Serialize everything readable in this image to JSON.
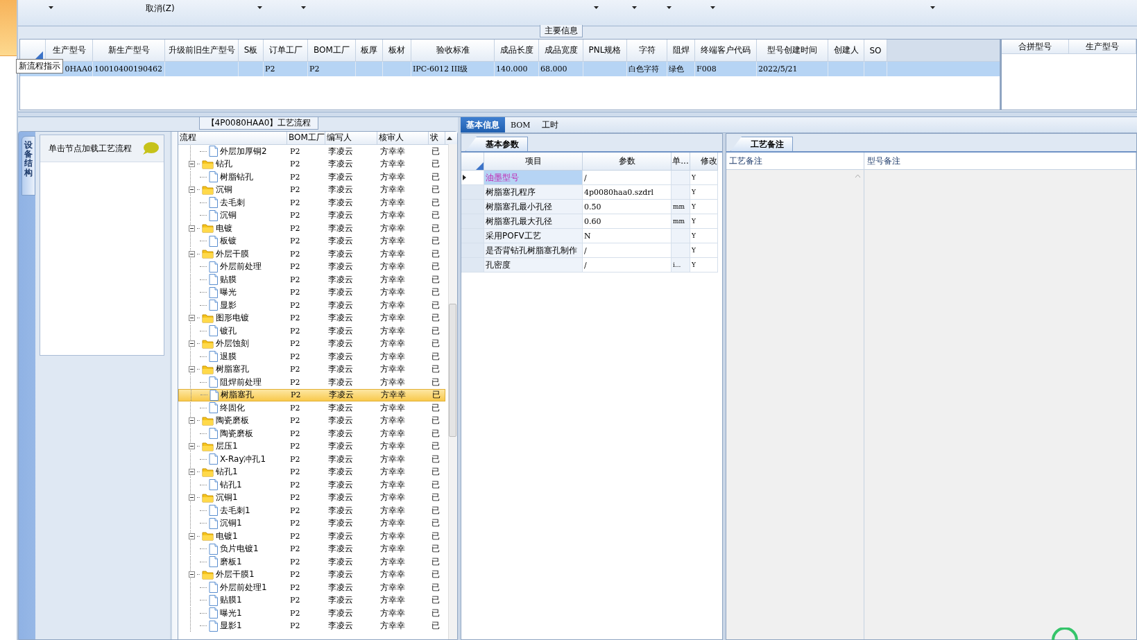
{
  "toolbar": {
    "cancel_label": "取消(Z)"
  },
  "main_info": {
    "title": "主要信息",
    "tooltip": "新流程指示",
    "columns": [
      "生产型号",
      "新生产型号",
      "升级前旧生产型号",
      "S板",
      "订单工厂",
      "BOM工厂",
      "板厚",
      "板材",
      "验收标准",
      "成品长度",
      "成品宽度",
      "PNL规格",
      "字符",
      "阻焊",
      "终端客户代码",
      "型号创建时间",
      "创建人",
      "SO"
    ],
    "rows": [
      {
        "selected": true,
        "cells": [
          "0HAA0",
          "10010400190462",
          "",
          "",
          "P2",
          "P2",
          "",
          "",
          "IPC-6012 III级",
          "140.000",
          "68.000",
          "",
          "白色字符",
          "绿色",
          "F008",
          "2022/5/21",
          "",
          ""
        ]
      }
    ],
    "side_columns": [
      "合拼型号",
      "生产型号"
    ]
  },
  "flow": {
    "title": "【4P0080HAA0】工艺流程",
    "side_tab": "设备结构",
    "hint": "单击节点加载工艺流程",
    "columns": [
      "流程",
      "BOM工厂",
      "编写人",
      "核审人",
      "状"
    ],
    "tree": [
      {
        "name": "外层加厚铜2",
        "kind": "file",
        "selected": false,
        "bom": "P2",
        "writer": "李凌云",
        "reviewer": "方幸幸",
        "status": "已"
      },
      {
        "name": "钻孔",
        "kind": "folder",
        "expanded": true,
        "selected": false,
        "bom": "P2",
        "writer": "李凌云",
        "reviewer": "方幸幸",
        "status": "已",
        "children": [
          {
            "name": "树脂钻孔",
            "kind": "file",
            "selected": false,
            "bom": "P2",
            "writer": "李凌云",
            "reviewer": "方幸幸",
            "status": "已"
          }
        ]
      },
      {
        "name": "沉铜",
        "kind": "folder",
        "expanded": true,
        "selected": false,
        "bom": "P2",
        "writer": "李凌云",
        "reviewer": "方幸幸",
        "status": "已",
        "children": [
          {
            "name": "去毛刺",
            "kind": "file",
            "selected": false,
            "bom": "P2",
            "writer": "李凌云",
            "reviewer": "方幸幸",
            "status": "已"
          },
          {
            "name": "沉铜",
            "kind": "file",
            "selected": false,
            "bom": "P2",
            "writer": "李凌云",
            "reviewer": "方幸幸",
            "status": "已"
          }
        ]
      },
      {
        "name": "电镀",
        "kind": "folder",
        "expanded": true,
        "selected": false,
        "bom": "P2",
        "writer": "李凌云",
        "reviewer": "方幸幸",
        "status": "已",
        "children": [
          {
            "name": "板镀",
            "kind": "file",
            "selected": false,
            "bom": "P2",
            "writer": "李凌云",
            "reviewer": "方幸幸",
            "status": "已"
          }
        ]
      },
      {
        "name": "外层干膜",
        "kind": "folder",
        "expanded": true,
        "selected": false,
        "bom": "P2",
        "writer": "李凌云",
        "reviewer": "方幸幸",
        "status": "已",
        "children": [
          {
            "name": "外层前处理",
            "kind": "file",
            "selected": false,
            "bom": "P2",
            "writer": "李凌云",
            "reviewer": "方幸幸",
            "status": "已"
          },
          {
            "name": "贴膜",
            "kind": "file",
            "selected": false,
            "bom": "P2",
            "writer": "李凌云",
            "reviewer": "方幸幸",
            "status": "已"
          },
          {
            "name": "曝光",
            "kind": "file",
            "selected": false,
            "bom": "P2",
            "writer": "李凌云",
            "reviewer": "方幸幸",
            "status": "已"
          },
          {
            "name": "显影",
            "kind": "file",
            "selected": false,
            "bom": "P2",
            "writer": "李凌云",
            "reviewer": "方幸幸",
            "status": "已"
          }
        ]
      },
      {
        "name": "图形电镀",
        "kind": "folder",
        "expanded": true,
        "selected": false,
        "bom": "P2",
        "writer": "李凌云",
        "reviewer": "方幸幸",
        "status": "已",
        "children": [
          {
            "name": "镀孔",
            "kind": "file",
            "selected": false,
            "bom": "P2",
            "writer": "李凌云",
            "reviewer": "方幸幸",
            "status": "已"
          }
        ]
      },
      {
        "name": "外层蚀刻",
        "kind": "folder",
        "expanded": true,
        "selected": false,
        "bom": "P2",
        "writer": "李凌云",
        "reviewer": "方幸幸",
        "status": "已",
        "children": [
          {
            "name": "退膜",
            "kind": "file",
            "selected": false,
            "bom": "P2",
            "writer": "李凌云",
            "reviewer": "方幸幸",
            "status": "已"
          }
        ]
      },
      {
        "name": "树脂塞孔",
        "kind": "folder",
        "expanded": true,
        "selected": false,
        "bom": "P2",
        "writer": "李凌云",
        "reviewer": "方幸幸",
        "status": "已",
        "children": [
          {
            "name": "阻焊前处理",
            "kind": "file",
            "selected": false,
            "bom": "P2",
            "writer": "李凌云",
            "reviewer": "方幸幸",
            "status": "已"
          },
          {
            "name": "树脂塞孔",
            "kind": "file",
            "selected": true,
            "bom": "P2",
            "writer": "李凌云",
            "reviewer": "方幸幸",
            "status": "已"
          },
          {
            "name": "终固化",
            "kind": "file",
            "selected": false,
            "bom": "P2",
            "writer": "李凌云",
            "reviewer": "方幸幸",
            "status": "已"
          }
        ]
      },
      {
        "name": "陶瓷磨板",
        "kind": "folder",
        "expanded": true,
        "selected": false,
        "bom": "P2",
        "writer": "李凌云",
        "reviewer": "方幸幸",
        "status": "已",
        "children": [
          {
            "name": "陶瓷磨板",
            "kind": "file",
            "selected": false,
            "bom": "P2",
            "writer": "李凌云",
            "reviewer": "方幸幸",
            "status": "已"
          }
        ]
      },
      {
        "name": "层压1",
        "kind": "folder",
        "expanded": true,
        "selected": false,
        "bom": "P2",
        "writer": "李凌云",
        "reviewer": "方幸幸",
        "status": "已",
        "children": [
          {
            "name": "X-Ray冲孔1",
            "kind": "file",
            "selected": false,
            "bom": "P2",
            "writer": "李凌云",
            "reviewer": "方幸幸",
            "status": "已"
          }
        ]
      },
      {
        "name": "钻孔1",
        "kind": "folder",
        "expanded": true,
        "selected": false,
        "bom": "P2",
        "writer": "李凌云",
        "reviewer": "方幸幸",
        "status": "已",
        "children": [
          {
            "name": "钻孔1",
            "kind": "file",
            "selected": false,
            "bom": "P2",
            "writer": "李凌云",
            "reviewer": "方幸幸",
            "status": "已"
          }
        ]
      },
      {
        "name": "沉铜1",
        "kind": "folder",
        "expanded": true,
        "selected": false,
        "bom": "P2",
        "writer": "李凌云",
        "reviewer": "方幸幸",
        "status": "已",
        "children": [
          {
            "name": "去毛刺1",
            "kind": "file",
            "selected": false,
            "bom": "P2",
            "writer": "李凌云",
            "reviewer": "方幸幸",
            "status": "已"
          },
          {
            "name": "沉铜1",
            "kind": "file",
            "selected": false,
            "bom": "P2",
            "writer": "李凌云",
            "reviewer": "方幸幸",
            "status": "已"
          }
        ]
      },
      {
        "name": "电镀1",
        "kind": "folder",
        "expanded": true,
        "selected": false,
        "bom": "P2",
        "writer": "李凌云",
        "reviewer": "方幸幸",
        "status": "已",
        "children": [
          {
            "name": "负片电镀1",
            "kind": "file",
            "selected": false,
            "bom": "P2",
            "writer": "李凌云",
            "reviewer": "方幸幸",
            "status": "已"
          },
          {
            "name": "磨板1",
            "kind": "file",
            "selected": false,
            "bom": "P2",
            "writer": "李凌云",
            "reviewer": "方幸幸",
            "status": "已"
          }
        ]
      },
      {
        "name": "外层干膜1",
        "kind": "folder",
        "expanded": true,
        "selected": false,
        "bom": "P2",
        "writer": "李凌云",
        "reviewer": "方幸幸",
        "status": "已",
        "children": [
          {
            "name": "外层前处理1",
            "kind": "file",
            "selected": false,
            "bom": "P2",
            "writer": "李凌云",
            "reviewer": "方幸幸",
            "status": "已"
          },
          {
            "name": "贴膜1",
            "kind": "file",
            "selected": false,
            "bom": "P2",
            "writer": "李凌云",
            "reviewer": "方幸幸",
            "status": "已"
          },
          {
            "name": "曝光1",
            "kind": "file",
            "selected": false,
            "bom": "P2",
            "writer": "李凌云",
            "reviewer": "方幸幸",
            "status": "已"
          },
          {
            "name": "显影1",
            "kind": "file",
            "selected": false,
            "bom": "P2",
            "writer": "李凌云",
            "reviewer": "方幸幸",
            "status": "已"
          }
        ]
      }
    ]
  },
  "detail": {
    "tabs": [
      {
        "label": "基本信息",
        "selected": true
      },
      {
        "label": "BOM",
        "selected": false
      },
      {
        "label": "工时",
        "selected": false
      }
    ],
    "params_tab": "基本参数",
    "params_columns": [
      "项目",
      "参数",
      "单...",
      "修改"
    ],
    "params": [
      {
        "item": "油墨型号",
        "value": "/",
        "modified": "Y",
        "selected": true
      },
      {
        "item": "树脂塞孔程序",
        "value": "4p0080haa0.szdrl",
        "modified": "Y",
        "selected": false
      },
      {
        "item": "树脂塞孔最小孔径",
        "value": "0.50",
        "unit": "mm",
        "modified": "Y",
        "selected": false
      },
      {
        "item": "树脂塞孔最大孔径",
        "value": "0.60",
        "unit": "mm",
        "modified": "Y",
        "selected": false
      },
      {
        "item": "采用POFV工艺",
        "value": "N",
        "modified": "Y",
        "selected": false
      },
      {
        "item": "是否背钻孔树脂塞孔制作",
        "value": "/",
        "modified": "Y",
        "selected": false
      },
      {
        "item": "孔密度",
        "value": "/",
        "unit": "i...",
        "modified": "Y",
        "selected": false
      }
    ],
    "notes_tab": "工艺备注",
    "notes_columns": [
      "工艺备注",
      "型号备注"
    ]
  }
}
